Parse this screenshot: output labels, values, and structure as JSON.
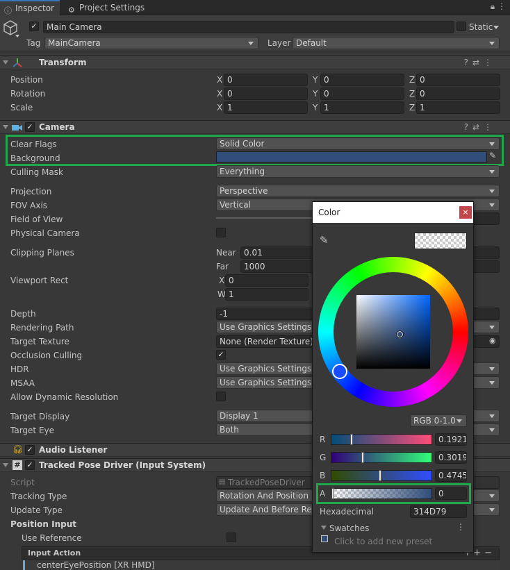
{
  "tabs": [
    {
      "label": "Inspector"
    },
    {
      "label": "Project Settings"
    }
  ],
  "gameobject": {
    "name": "Main Camera",
    "static_label": "Static",
    "tag_label": "Tag",
    "tag_value": "MainCamera",
    "layer_label": "Layer",
    "layer_value": "Default"
  },
  "transform": {
    "title": "Transform",
    "rows": [
      {
        "label": "Position",
        "x": "0",
        "y": "0",
        "z": "0"
      },
      {
        "label": "Rotation",
        "x": "0",
        "y": "0",
        "z": "0"
      },
      {
        "label": "Scale",
        "x": "1",
        "y": "1",
        "z": "1"
      }
    ],
    "axes": {
      "x": "X",
      "y": "Y",
      "z": "Z"
    }
  },
  "camera": {
    "title": "Camera",
    "clear_flags_label": "Clear Flags",
    "clear_flags_value": "Solid Color",
    "background_label": "Background",
    "background_color": "#314D79",
    "culling_mask_label": "Culling Mask",
    "culling_mask_value": "Everything",
    "projection_label": "Projection",
    "projection_value": "Perspective",
    "fov_axis_label": "FOV Axis",
    "fov_axis_value": "Vertical",
    "fov_label": "Field of View",
    "physical_camera_label": "Physical Camera",
    "clipping_label": "Clipping Planes",
    "near_label": "Near",
    "near_value": "0.01",
    "far_label": "Far",
    "far_value": "1000",
    "viewport_label": "Viewport Rect",
    "vp_x_label": "X",
    "vp_x_value": "0",
    "vp_w_label": "W",
    "vp_w_value": "1",
    "depth_label": "Depth",
    "depth_value": "-1",
    "rendering_path_label": "Rendering Path",
    "rendering_path_value": "Use Graphics Settings",
    "target_texture_label": "Target Texture",
    "target_texture_value": "None (Render Texture)",
    "occlusion_label": "Occlusion Culling",
    "hdr_label": "HDR",
    "hdr_value": "Use Graphics Settings",
    "msaa_label": "MSAA",
    "msaa_value": "Use Graphics Settings",
    "dyn_res_label": "Allow Dynamic Resolution",
    "target_display_label": "Target Display",
    "target_display_value": "Display 1",
    "target_eye_label": "Target Eye",
    "target_eye_value": "Both"
  },
  "audio_listener": {
    "title": "Audio Listener"
  },
  "tracked_pose": {
    "title": "Tracked Pose Driver (Input System)",
    "script_label": "Script",
    "script_value": "TrackedPoseDriver",
    "tracking_type_label": "Tracking Type",
    "tracking_type_value": "Rotation And Position",
    "update_type_label": "Update Type",
    "update_type_value": "Update And Before Render",
    "position_input_label": "Position Input",
    "use_reference_label": "Use Reference",
    "input_action_label": "Input Action",
    "binding_value": "centerEyePosition [XR HMD]"
  },
  "color_picker": {
    "title": "Color",
    "close_label": "×",
    "mode_value": "RGB 0-1.0",
    "r_label": "R",
    "r_value": "0.19215",
    "g_label": "G",
    "g_value": "0.30196",
    "b_label": "B",
    "b_value": "0.47450",
    "a_label": "A",
    "a_value": "0",
    "hex_label": "Hexadecimal",
    "hex_value": "314D79",
    "swatches_label": "Swatches",
    "swatches_hint": "Click to add new preset"
  },
  "colors": {
    "accent_highlight": "#1fa84a",
    "tab_accent": "#3a79bb",
    "close_red": "#c0474a"
  }
}
